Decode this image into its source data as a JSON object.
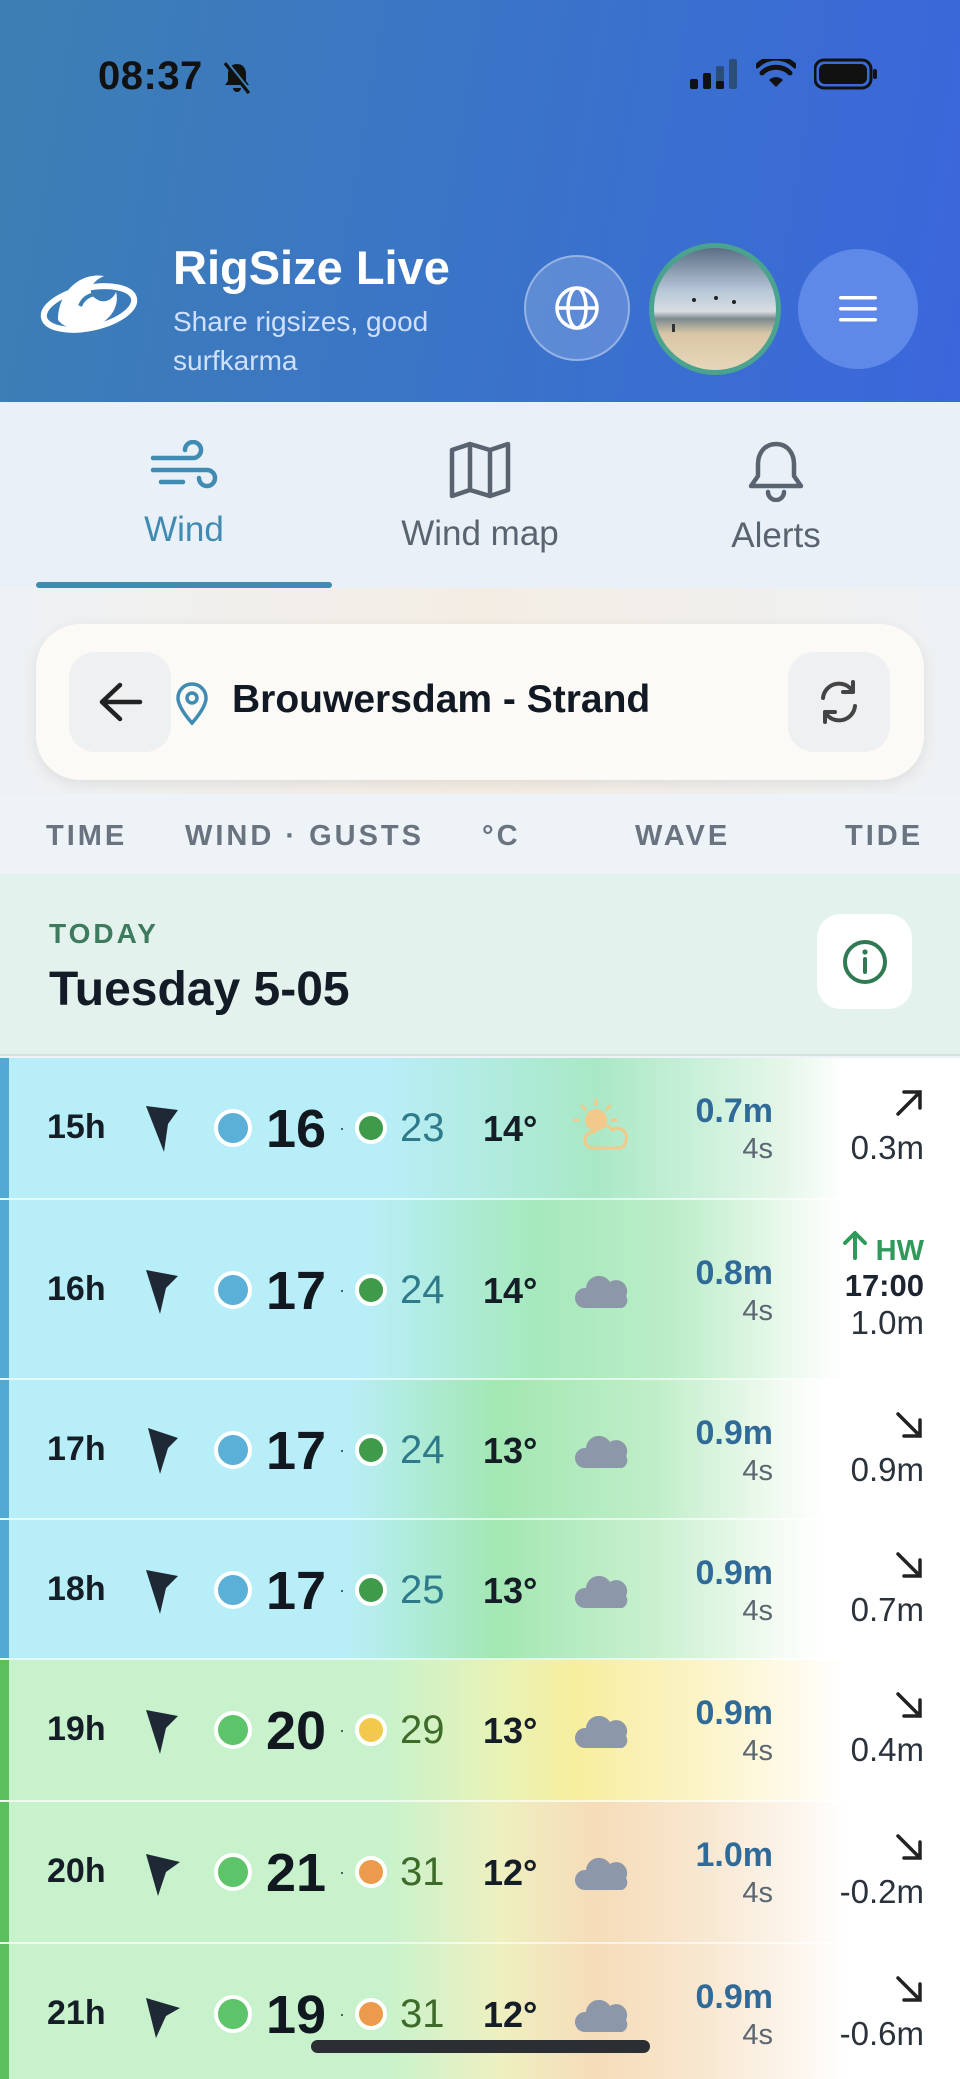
{
  "status_bar": {
    "time": "08:37"
  },
  "header": {
    "title": "RigSize Live",
    "subtitle": "Share rigsizes, good surfkarma"
  },
  "tabs": [
    {
      "label": "Wind",
      "icon": "wind-icon",
      "active": true
    },
    {
      "label": "Wind map",
      "icon": "map-icon",
      "active": false
    },
    {
      "label": "Alerts",
      "icon": "bell-icon",
      "active": false
    }
  ],
  "location": {
    "name": "Brouwersdam - Strand"
  },
  "columns": {
    "time": "TIME",
    "wind": "WIND · GUSTS",
    "temp": "°C",
    "wave": "WAVE",
    "tide": "TIDE"
  },
  "day": {
    "label": "TODAY",
    "name": "Tuesday 5-05"
  },
  "rows": [
    {
      "time": "15h",
      "wind": "16",
      "sep": "·",
      "gust": "23",
      "temp": "14°",
      "weather": "partly-sunny-icon",
      "wave": "0.7m",
      "period": "4s",
      "tide_dir": "up-right-arrow-icon",
      "tide": "0.3m"
    },
    {
      "time": "16h",
      "wind": "17",
      "sep": "·",
      "gust": "24",
      "temp": "14°",
      "weather": "cloud-icon",
      "wave": "0.8m",
      "period": "4s",
      "tide_hw": "HW",
      "tide_time": "17:00",
      "tide": "1.0m"
    },
    {
      "time": "17h",
      "wind": "17",
      "sep": "·",
      "gust": "24",
      "temp": "13°",
      "weather": "cloud-icon",
      "wave": "0.9m",
      "period": "4s",
      "tide_dir": "down-right-arrow-icon",
      "tide": "0.9m"
    },
    {
      "time": "18h",
      "wind": "17",
      "sep": "·",
      "gust": "25",
      "temp": "13°",
      "weather": "cloud-icon",
      "wave": "0.9m",
      "period": "4s",
      "tide_dir": "down-right-arrow-icon",
      "tide": "0.7m"
    },
    {
      "time": "19h",
      "wind": "20",
      "sep": "·",
      "gust": "29",
      "temp": "13°",
      "weather": "cloud-icon",
      "wave": "0.9m",
      "period": "4s",
      "tide_dir": "down-right-arrow-icon",
      "tide": "0.4m"
    },
    {
      "time": "20h",
      "wind": "21",
      "sep": "·",
      "gust": "31",
      "temp": "12°",
      "weather": "cloud-icon",
      "wave": "1.0m",
      "period": "4s",
      "tide_dir": "down-right-arrow-icon",
      "tide": "-0.2m"
    },
    {
      "time": "21h",
      "wind": "19",
      "sep": "·",
      "gust": "31",
      "temp": "12°",
      "weather": "cloud-icon",
      "wave": "0.9m",
      "period": "4s",
      "tide_dir": "down-right-arrow-icon",
      "tide": "-0.6m"
    }
  ],
  "colors": {
    "header_start": "#3d7fb3",
    "header_end": "#3b66dc",
    "accent": "#3f8bb2",
    "wind_blue": "#5ab0d6",
    "wind_green": "#5ec46a",
    "gust_green": "#3f9a4a",
    "gust_yellow": "#f2c94c",
    "gust_orange": "#ec9a4c"
  }
}
